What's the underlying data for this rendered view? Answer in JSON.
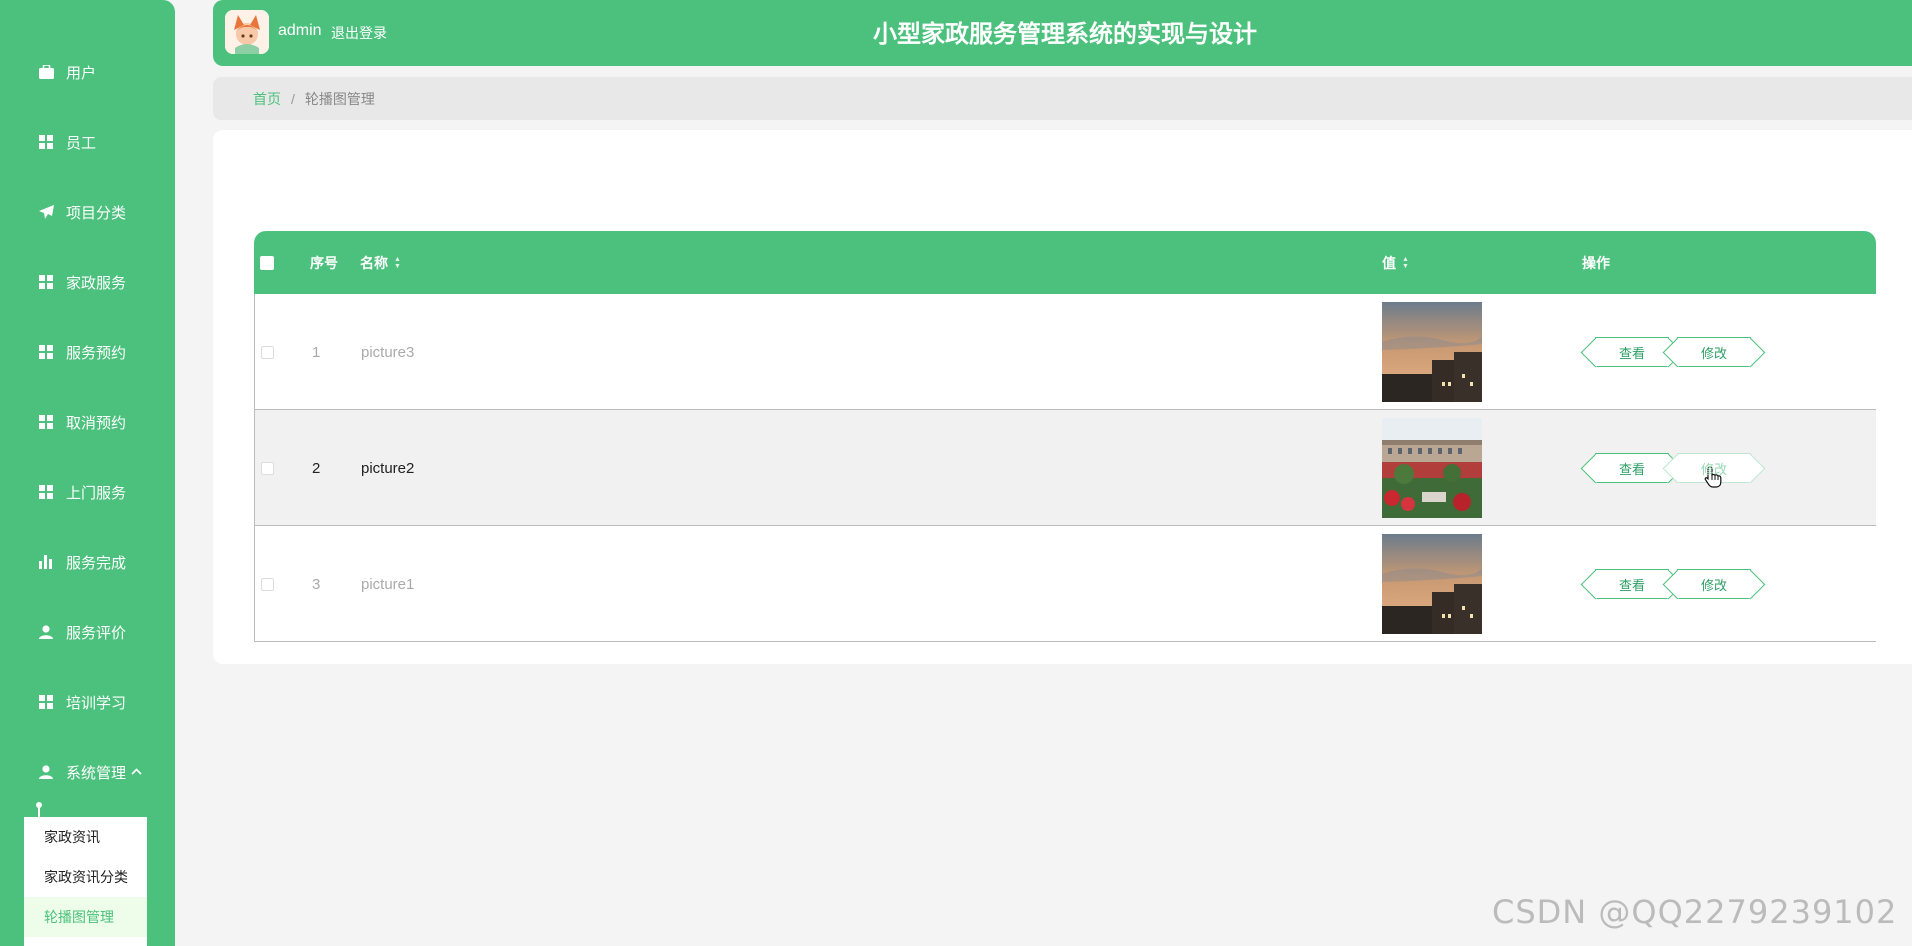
{
  "sidebar": {
    "items": [
      {
        "label": "用户",
        "icon": "briefcase-icon"
      },
      {
        "label": "员工",
        "icon": "grid-icon"
      },
      {
        "label": "项目分类",
        "icon": "paper-plane-icon"
      },
      {
        "label": "家政服务",
        "icon": "grid-icon"
      },
      {
        "label": "服务预约",
        "icon": "grid-icon"
      },
      {
        "label": "取消预约",
        "icon": "grid-icon"
      },
      {
        "label": "上门服务",
        "icon": "grid-icon"
      },
      {
        "label": "服务完成",
        "icon": "bar-chart-icon"
      },
      {
        "label": "服务评价",
        "icon": "user-icon"
      },
      {
        "label": "培训学习",
        "icon": "grid-icon"
      },
      {
        "label": "系统管理",
        "icon": "user-icon"
      }
    ],
    "submenu": [
      {
        "label": "家政资讯"
      },
      {
        "label": "家政资讯分类"
      },
      {
        "label": "轮播图管理"
      }
    ]
  },
  "header": {
    "username": "admin",
    "logout": "退出登录",
    "title": "小型家政服务管理系统的实现与设计"
  },
  "breadcrumb": {
    "home": "首页",
    "separator": "/",
    "current": "轮播图管理"
  },
  "table": {
    "headers": {
      "index": "序号",
      "name": "名称",
      "value": "值",
      "actions": "操作"
    },
    "rows": [
      {
        "index": "1",
        "name": "picture3",
        "view": "查看",
        "edit": "修改"
      },
      {
        "index": "2",
        "name": "picture2",
        "view": "查看",
        "edit": "修改"
      },
      {
        "index": "3",
        "name": "picture1",
        "view": "查看",
        "edit": "修改"
      }
    ]
  },
  "colors": {
    "primary": "#4cc17d",
    "active_submenu_bg": "#edfde9"
  },
  "watermark": "CSDN @QQ2279239102"
}
